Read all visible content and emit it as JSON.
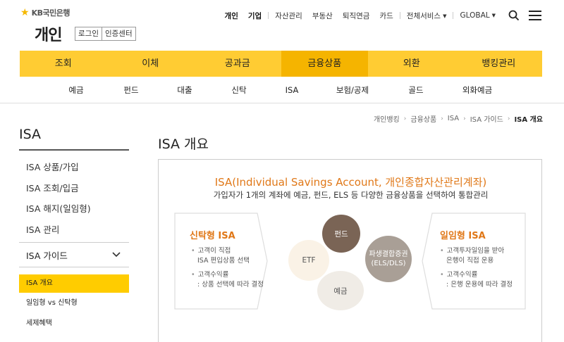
{
  "header": {
    "brand": "KB국민은행",
    "section_title": "개인",
    "login_button": "로그인",
    "cert_button": "인증센터",
    "top_links": {
      "personal": "개인",
      "corporate": "기업",
      "asset": "자산관리",
      "realestate": "부동산",
      "pension": "퇴직연금",
      "card": "카드",
      "all_services": "전체서비스",
      "global": "GLOBAL"
    },
    "icons": {
      "search": "search-icon",
      "menu": "hamburger-menu-icon"
    }
  },
  "main_nav": [
    "조회",
    "이체",
    "공과금",
    "금융상품",
    "외환",
    "뱅킹관리"
  ],
  "sub_nav": [
    "예금",
    "펀드",
    "대출",
    "신탁",
    "ISA",
    "보험/공제",
    "골드",
    "외화예금"
  ],
  "breadcrumb": [
    "개인뱅킹",
    "금융상품",
    "ISA",
    "ISA 가이드",
    "ISA 개요"
  ],
  "sidebar": {
    "title": "ISA",
    "items": [
      "ISA 상품/가입",
      "ISA 조회/입금",
      "ISA 해지(일임형)",
      "ISA 관리"
    ],
    "guide_label": "ISA 가이드",
    "sub_items": [
      "ISA 개요",
      "일임형 vs 신탁형",
      "세제혜택"
    ]
  },
  "content": {
    "title": "ISA 개요",
    "heading": "ISA(Individual Savings Account, 개인종합자산관리계좌)",
    "subheading": "가입자가 1개의 계좌에 예금, 펀드, ELS 등 다양한 금융상품을 선택하여 통합관리",
    "trust": {
      "title": "신탁형 ISA",
      "line1a": "고객이 직접",
      "line1b": "ISA 편입상품 선택",
      "line2a": "고객수익률",
      "line2b": ": 상품 선택에 따라 결정"
    },
    "discretionary": {
      "title": "일임형 ISA",
      "line1a": "고객투자일임을 받아",
      "line1b": "은행이 직접 운용",
      "line2a": "고객수익률",
      "line2b": ": 은행 운용에 따라 결정"
    },
    "circles": {
      "etf": "ETF",
      "fund": "펀드",
      "derivative_line1": "파생결합증권",
      "derivative_line2": "(ELS/DLS)",
      "deposit": "예금"
    }
  },
  "colors": {
    "main_nav_bg": "#ffcc33",
    "main_nav_active": "#f5b400",
    "accent_orange": "#e07818",
    "sidebar_active": "#ffcc00"
  }
}
